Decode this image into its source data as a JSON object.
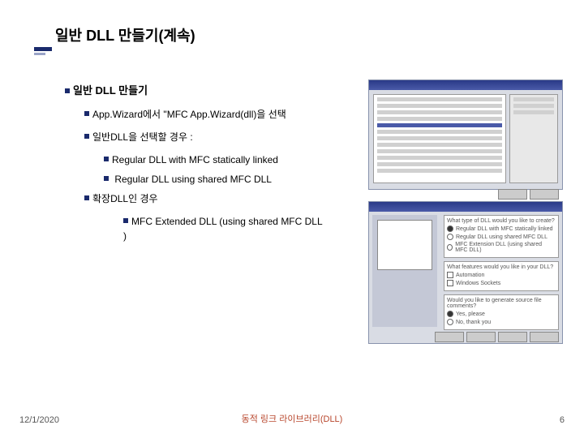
{
  "slide": {
    "title": "일반 DLL 만들기(계속)",
    "h1": "일반 DLL 만들기",
    "p1": "App.Wizard에서 \"MFC App.Wizard(dll)을 선택",
    "p2": "일반DLL을 선택할 경우 :",
    "p2a": "Regular DLL with MFC statically linked",
    "p2b": " Regular DLL using shared MFC DLL",
    "p3": "확장DLL인 경우",
    "p3a": "MFC Extended DLL (using shared MFC DLL )",
    "footer_date": "12/1/2020",
    "footer_title": "동적 링크 라이브러리(DLL)",
    "footer_num": "6"
  },
  "dialog2": {
    "q1": "What type of DLL would you like to create?",
    "r1": "Regular DLL with MFC statically linked",
    "r2": "Regular DLL using shared MFC DLL",
    "r3": "MFC Extension DLL (using shared MFC DLL)",
    "q2": "What features would you like in your DLL?",
    "c1": "Automation",
    "c2": "Windows Sockets",
    "q3": "Would you like to generate source file comments?",
    "y": "Yes, please",
    "n": "No, thank you"
  }
}
